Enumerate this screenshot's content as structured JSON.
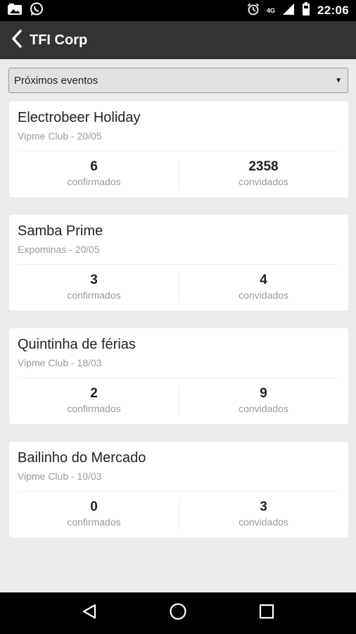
{
  "status_bar": {
    "time": "22:06",
    "network": "4G",
    "left_icons": [
      "photo-notification-icon",
      "whatsapp-icon"
    ],
    "right_icons": [
      "alarm-icon",
      "signal-icon",
      "battery-icon"
    ]
  },
  "app_bar": {
    "title": "TFI Corp"
  },
  "filter": {
    "selected": "Próximos eventos"
  },
  "events": [
    {
      "title": "Electrobeer Holiday",
      "subtitle": "Vipme Club  - 20/05",
      "confirmed": "6",
      "confirmed_label": "confirmados",
      "invited": "2358",
      "invited_label": "convidados"
    },
    {
      "title": "Samba Prime",
      "subtitle": "Expominas  - 20/05",
      "confirmed": "3",
      "confirmed_label": "confirmados",
      "invited": "4",
      "invited_label": "convidados"
    },
    {
      "title": "Quintinha de férias",
      "subtitle": "Vipme Club  - 18/03",
      "confirmed": "2",
      "confirmed_label": "confirmados",
      "invited": "9",
      "invited_label": "convidados"
    },
    {
      "title": "Bailinho do Mercado",
      "subtitle": "Vipme Club  - 10/03",
      "confirmed": "0",
      "confirmed_label": "confirmados",
      "invited": "3",
      "invited_label": "convidados"
    }
  ],
  "colors": {
    "app_bar": "#333333",
    "background": "#ebebeb",
    "card": "#ffffff"
  }
}
